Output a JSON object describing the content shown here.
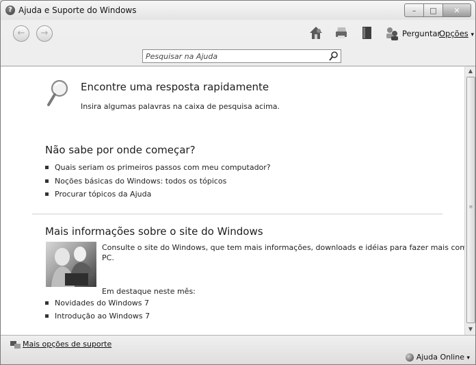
{
  "window": {
    "title": "Ajuda e Suporte do Windows",
    "title_icon": "help-icon",
    "minimize_glyph": "–",
    "maximize_glyph": "□",
    "close_glyph": "✕"
  },
  "toolbar": {
    "back_glyph": "←",
    "forward_glyph": "→",
    "icons": [
      "home-icon",
      "print-icon",
      "browse-help-icon",
      "ask-people-icon"
    ],
    "ask_label": "Perguntar",
    "options_label": "Opções",
    "options_arrow": "▾"
  },
  "search": {
    "placeholder": "Pesquisar na Ajuda",
    "value": "",
    "button_icon": "search-icon"
  },
  "main": {
    "quick_answer": {
      "heading": "Encontre uma resposta rapidamente",
      "text": "Insira algumas palavras na caixa de pesquisa acima."
    },
    "start": {
      "heading": "Não sabe por onde começar?",
      "links": [
        "Quais seriam os primeiros passos com meu computador?",
        "Noções básicas do Windows: todos os tópicos",
        "Procurar tópicos da Ajuda"
      ]
    },
    "website": {
      "heading": "Mais informações sobre o site do Windows",
      "text_line1": "Consulte o site do Windows, que tem mais informações, downloads e idéias para fazer mais com o seu",
      "text_line2": "PC.",
      "featured_label": "Em destaque neste mês:",
      "links": [
        "Novidades do Windows 7",
        "Introdução ao Windows 7"
      ]
    }
  },
  "scrollbar": {
    "up_glyph": "▲",
    "down_glyph": "▼",
    "grip_glyph": "≡"
  },
  "bottom": {
    "more_support": "Mais opções de suporte",
    "online_help": "Ajuda Online",
    "online_arrow": "▾"
  }
}
